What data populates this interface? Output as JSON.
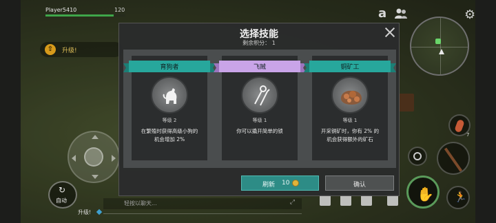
{
  "hud": {
    "player_name": "Player5410",
    "player_level": "120",
    "hp_fraction": 0.85,
    "levelup_left": "升级!",
    "top_letter": "a",
    "auto_label": "自动",
    "chat_level": "升级!",
    "chat_placeholder": "轻按以聊天...",
    "feather_count": "7"
  },
  "dialog": {
    "title": "选择技能",
    "remaining_points": "剩余积分： 1",
    "cards": [
      {
        "name": "育狗者",
        "ribbon_color": "teal",
        "icon": "dog-icon",
        "level": "等级 2",
        "desc_line1": "在繁殖时获得高级小狗的",
        "desc_line2": "机会增加 2%"
      },
      {
        "name": "飞贼",
        "ribbon_color": "purple",
        "icon": "lockpick-icon",
        "level": "等级 1",
        "desc_line1": "你可以撬开简单的锁",
        "desc_line2": ""
      },
      {
        "name": "铜矿工",
        "ribbon_color": "teal",
        "icon": "copper-ore-icon",
        "level": "等级 1",
        "desc_line1": "开采铜矿时，你有 2% 的",
        "desc_line2": "机会获得额外的矿石"
      }
    ],
    "refresh_label": "刷新",
    "refresh_cost": "10",
    "confirm_label": "确认"
  },
  "colors": {
    "teal_ribbon": "#27a79c",
    "purple_ribbon": "#c9a4e8",
    "refresh_button": "#2d8c86",
    "hp_bar": "#3fa64a"
  }
}
